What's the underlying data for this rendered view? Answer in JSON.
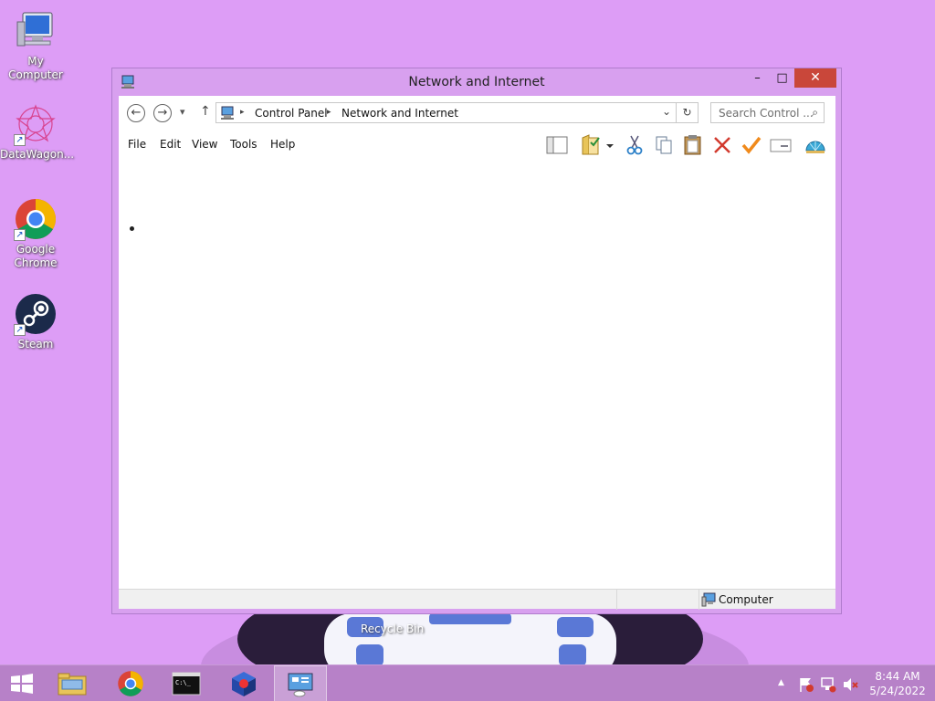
{
  "desktop": {
    "icons": [
      {
        "label": "My Computer",
        "icon": "my-computer-icon"
      },
      {
        "label": "DataWagon...",
        "icon": "datawagon-icon"
      },
      {
        "label": "Google Chrome",
        "icon": "chrome-icon"
      },
      {
        "label": "Steam",
        "icon": "steam-icon"
      }
    ],
    "recycle_bin_label": "Recycle Bin"
  },
  "window": {
    "title": "Network and Internet",
    "minimize_glyph": "–",
    "maximize_glyph": "□",
    "close_glyph": "✕",
    "address": {
      "back_glyph": "←",
      "forward_glyph": "→",
      "recent_glyph": "▾",
      "up_glyph": "↑",
      "crumbs": [
        "Control Panel",
        "Network and Internet"
      ],
      "separator_glyph": "▸",
      "dropdown_glyph": "⌄",
      "refresh_glyph": "↻"
    },
    "search": {
      "placeholder": "Search Control ...",
      "icon_glyph": "⌕"
    },
    "menu": [
      "File",
      "Edit",
      "View",
      "Tools",
      "Help"
    ],
    "toolbar_icons": [
      "layout-icon",
      "folder-options-icon",
      "cut-icon",
      "copy-icon",
      "paste-icon",
      "delete-icon",
      "checkmark-icon",
      "properties-icon",
      "shell-icon"
    ],
    "status": {
      "location": "Computer"
    }
  },
  "taskbar": {
    "apps": [
      "file-explorer-icon",
      "chrome-icon",
      "terminal-icon",
      "app-cube-icon",
      "control-panel-icon"
    ],
    "clock": {
      "time": "8:44 AM",
      "date": "5/24/2022"
    },
    "tray_chevron": "▲"
  },
  "colors": {
    "desktop_bg": "#dd9df6",
    "window_frame": "#d8a0ef",
    "close_button": "#c9473a",
    "taskbar": "#b781c8"
  }
}
